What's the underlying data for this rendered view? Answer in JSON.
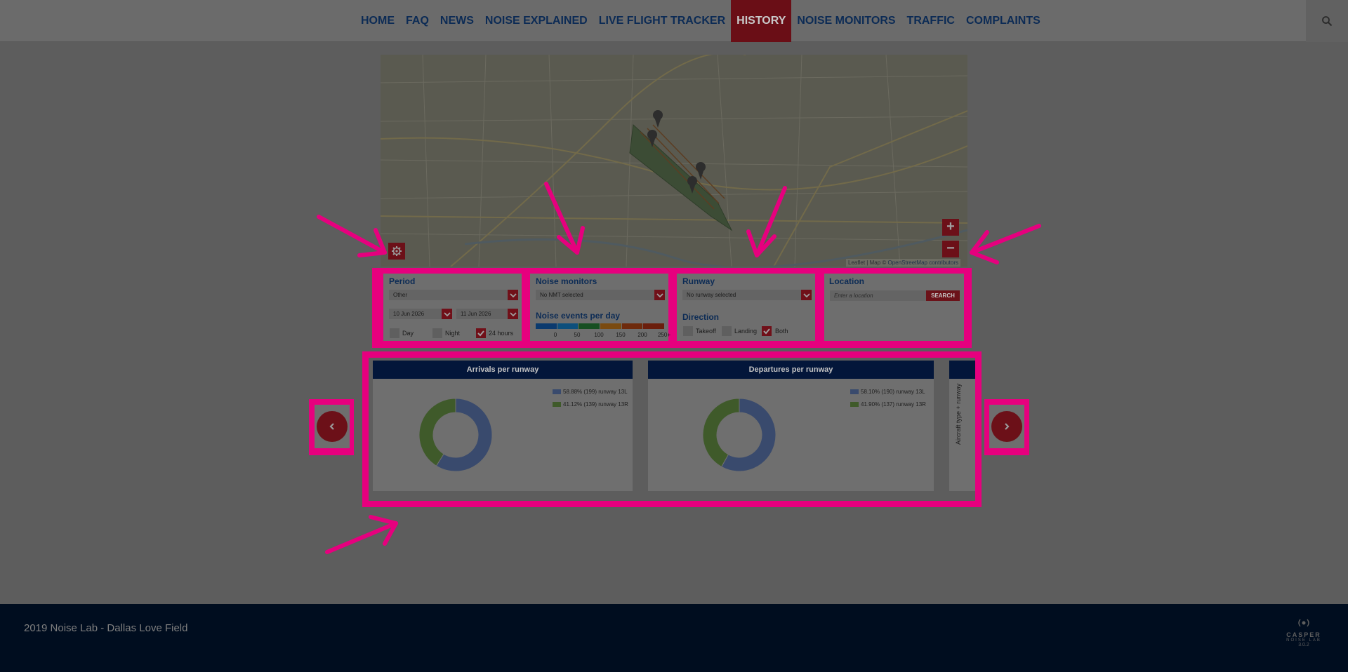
{
  "nav": {
    "items": [
      {
        "label": "HOME"
      },
      {
        "label": "FAQ"
      },
      {
        "label": "NEWS"
      },
      {
        "label": "NOISE EXPLAINED"
      },
      {
        "label": "LIVE FLIGHT TRACKER"
      },
      {
        "label": "HISTORY",
        "active": true
      },
      {
        "label": "NOISE MONITORS"
      },
      {
        "label": "TRAFFIC"
      },
      {
        "label": "COMPLAINTS"
      }
    ],
    "search_icon": "search-icon"
  },
  "map": {
    "zoom_in": "+",
    "zoom_out": "−",
    "attribution_leaflet": "Leaflet",
    "attribution_sep": " | Map © ",
    "attribution_osm": "OpenStreetMap contributors",
    "settings_icon": "gear-icon"
  },
  "period": {
    "title": "Period",
    "selected": "Other",
    "start_date": "10 Jun 2026",
    "end_date": "11 Jun 2026",
    "day_label": "Day",
    "night_label": "Night",
    "all_label": "24 hours",
    "day_checked": false,
    "night_checked": false,
    "all_checked": true
  },
  "noise_monitors": {
    "title": "Noise monitors",
    "selected": "No NMT selected",
    "events_title": "Noise events per day",
    "scale_labels": [
      "0",
      "50",
      "100",
      "150",
      "200",
      "250+"
    ],
    "scale_colors": [
      "#0b3a6e",
      "#0d4f7c",
      "#174f22",
      "#7a4a10",
      "#6e2a0c",
      "#6b1e0c"
    ]
  },
  "runway": {
    "title": "Runway",
    "selected": "No runway selected",
    "direction_title": "Direction",
    "takeoff_label": "Takeoff",
    "landing_label": "Landing",
    "both_label": "Both",
    "takeoff_checked": false,
    "landing_checked": false,
    "both_checked": true
  },
  "location": {
    "title": "Location",
    "placeholder": "Enter a location",
    "search_label": "SEARCH"
  },
  "charts": {
    "arrivals": {
      "title": "Arrivals per runway",
      "legend": [
        "58.88% (199) runway 13L",
        "41.12% (139) runway 13R"
      ]
    },
    "departures": {
      "title": "Departures per runway",
      "legend": [
        "58.10% (190) runway 13L",
        "41.90% (137) runway 13R"
      ]
    },
    "third": {
      "axis_label": "Aircraft type + runway"
    }
  },
  "chart_data": [
    {
      "type": "pie",
      "title": "Arrivals per runway",
      "categories": [
        "runway 13L",
        "runway 13R"
      ],
      "values": [
        199,
        139
      ],
      "percentages": [
        58.88,
        41.12
      ],
      "colors": [
        "#394a6d",
        "#3f5a2a"
      ]
    },
    {
      "type": "pie",
      "title": "Departures per runway",
      "categories": [
        "runway 13L",
        "runway 13R"
      ],
      "values": [
        190,
        137
      ],
      "percentages": [
        58.1,
        41.9
      ],
      "colors": [
        "#394a6d",
        "#3f5a2a"
      ]
    }
  ],
  "carousel": {
    "prev_icon": "chevron-left-icon",
    "next_icon": "chevron-right-icon"
  },
  "footer": {
    "copyright": "2019 Noise Lab - Dallas Love Field",
    "brand": "CASPER",
    "brand_sub": "NOISE LAB",
    "version": "3.0.2"
  }
}
